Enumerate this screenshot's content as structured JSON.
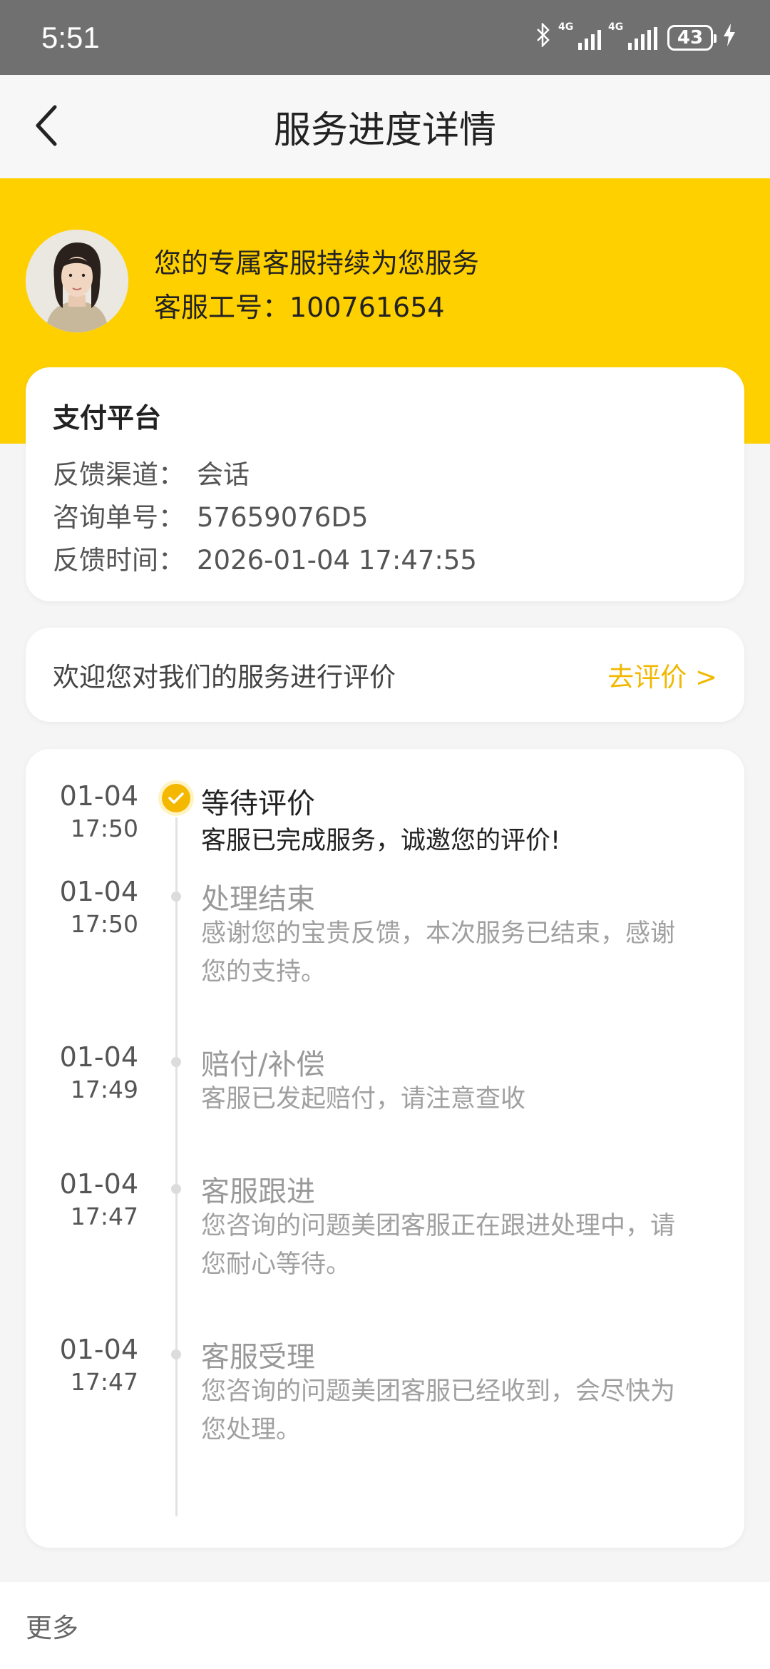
{
  "status_bar": {
    "time": "5:51",
    "network_1": "4G",
    "network_2": "4G",
    "battery": "43"
  },
  "header": {
    "title": "服务进度详情"
  },
  "agent": {
    "greeting": "您的专属客服持续为您服务",
    "id_line": "客服工号：100761654"
  },
  "info_card": {
    "title": "支付平台",
    "rows": [
      {
        "label": "反馈渠道：",
        "value": "会话"
      },
      {
        "label": "咨询单号：",
        "value": "57659076D5"
      },
      {
        "label": "反馈时间：",
        "value": "2026-01-04 17:47:55"
      }
    ]
  },
  "rating": {
    "prompt": "欢迎您对我们的服务进行评价",
    "link": "去评价 >"
  },
  "timeline": [
    {
      "date": "01-04",
      "time": "17:50",
      "title": "等待评价",
      "desc": "客服已完成服务，诚邀您的评价!",
      "active": true
    },
    {
      "date": "01-04",
      "time": "17:50",
      "title": "处理结束",
      "desc": "感谢您的宝贵反馈，本次服务已结束，感谢您的支持。",
      "active": false
    },
    {
      "date": "01-04",
      "time": "17:49",
      "title": "赔付/补偿",
      "desc": "客服已发起赔付，请注意查收",
      "active": false
    },
    {
      "date": "01-04",
      "time": "17:47",
      "title": "客服跟进",
      "desc": "您咨询的问题美团客服正在跟进处理中，请您耐心等待。",
      "active": false
    },
    {
      "date": "01-04",
      "time": "17:47",
      "title": "客服受理",
      "desc": "您咨询的问题美团客服已经收到，会尽快为您处理。",
      "active": false
    }
  ],
  "footer": {
    "more": "更多"
  },
  "colors": {
    "brand_yellow": "#ffd000",
    "accent": "#f2b800"
  },
  "icons": {
    "back": "chevron-left-icon",
    "check": "check-circle-icon",
    "bluetooth": "bluetooth-icon",
    "battery": "battery-icon",
    "charging": "bolt-icon"
  }
}
